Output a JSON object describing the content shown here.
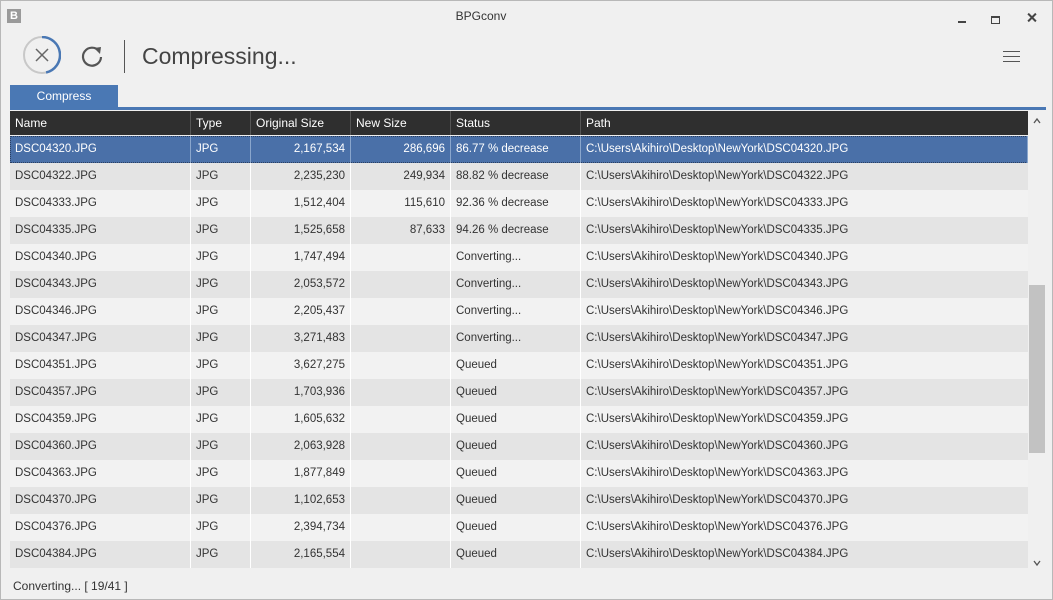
{
  "window": {
    "title": "BPGconv",
    "app_icon": "B",
    "icons": {
      "minimize": "minimize-icon",
      "maximize": "maximize-icon",
      "close": "close-icon"
    }
  },
  "toolbar": {
    "status_heading": "Compressing...",
    "icons": {
      "cancel": "cancel-x-circle-icon",
      "refresh": "refresh-icon",
      "menu": "hamburger-menu-icon"
    },
    "progress_fraction": 0.4634
  },
  "tabs": [
    {
      "label": "Compress",
      "active": true
    }
  ],
  "colors": {
    "accent": "#4a78b4",
    "selected_row": "#4a70a8",
    "header_bg": "#2f2f2f"
  },
  "table": {
    "columns": [
      "Name",
      "Type",
      "Original Size",
      "New Size",
      "Status",
      "Path"
    ],
    "rows": [
      {
        "name": "DSC04320.JPG",
        "type": "JPG",
        "original_size": "2,167,534",
        "new_size": "286,696",
        "status": "86.77 % decrease",
        "path": "C:\\Users\\Akihiro\\Desktop\\NewYork\\DSC04320.JPG",
        "selected": true
      },
      {
        "name": "DSC04322.JPG",
        "type": "JPG",
        "original_size": "2,235,230",
        "new_size": "249,934",
        "status": "88.82 % decrease",
        "path": "C:\\Users\\Akihiro\\Desktop\\NewYork\\DSC04322.JPG"
      },
      {
        "name": "DSC04333.JPG",
        "type": "JPG",
        "original_size": "1,512,404",
        "new_size": "115,610",
        "status": "92.36 % decrease",
        "path": "C:\\Users\\Akihiro\\Desktop\\NewYork\\DSC04333.JPG"
      },
      {
        "name": "DSC04335.JPG",
        "type": "JPG",
        "original_size": "1,525,658",
        "new_size": "87,633",
        "status": "94.26 % decrease",
        "path": "C:\\Users\\Akihiro\\Desktop\\NewYork\\DSC04335.JPG"
      },
      {
        "name": "DSC04340.JPG",
        "type": "JPG",
        "original_size": "1,747,494",
        "new_size": "",
        "status": "Converting...",
        "path": "C:\\Users\\Akihiro\\Desktop\\NewYork\\DSC04340.JPG"
      },
      {
        "name": "DSC04343.JPG",
        "type": "JPG",
        "original_size": "2,053,572",
        "new_size": "",
        "status": "Converting...",
        "path": "C:\\Users\\Akihiro\\Desktop\\NewYork\\DSC04343.JPG"
      },
      {
        "name": "DSC04346.JPG",
        "type": "JPG",
        "original_size": "2,205,437",
        "new_size": "",
        "status": "Converting...",
        "path": "C:\\Users\\Akihiro\\Desktop\\NewYork\\DSC04346.JPG"
      },
      {
        "name": "DSC04347.JPG",
        "type": "JPG",
        "original_size": "3,271,483",
        "new_size": "",
        "status": "Converting...",
        "path": "C:\\Users\\Akihiro\\Desktop\\NewYork\\DSC04347.JPG"
      },
      {
        "name": "DSC04351.JPG",
        "type": "JPG",
        "original_size": "3,627,275",
        "new_size": "",
        "status": "Queued",
        "path": "C:\\Users\\Akihiro\\Desktop\\NewYork\\DSC04351.JPG"
      },
      {
        "name": "DSC04357.JPG",
        "type": "JPG",
        "original_size": "1,703,936",
        "new_size": "",
        "status": "Queued",
        "path": "C:\\Users\\Akihiro\\Desktop\\NewYork\\DSC04357.JPG"
      },
      {
        "name": "DSC04359.JPG",
        "type": "JPG",
        "original_size": "1,605,632",
        "new_size": "",
        "status": "Queued",
        "path": "C:\\Users\\Akihiro\\Desktop\\NewYork\\DSC04359.JPG"
      },
      {
        "name": "DSC04360.JPG",
        "type": "JPG",
        "original_size": "2,063,928",
        "new_size": "",
        "status": "Queued",
        "path": "C:\\Users\\Akihiro\\Desktop\\NewYork\\DSC04360.JPG"
      },
      {
        "name": "DSC04363.JPG",
        "type": "JPG",
        "original_size": "1,877,849",
        "new_size": "",
        "status": "Queued",
        "path": "C:\\Users\\Akihiro\\Desktop\\NewYork\\DSC04363.JPG"
      },
      {
        "name": "DSC04370.JPG",
        "type": "JPG",
        "original_size": "1,102,653",
        "new_size": "",
        "status": "Queued",
        "path": "C:\\Users\\Akihiro\\Desktop\\NewYork\\DSC04370.JPG"
      },
      {
        "name": "DSC04376.JPG",
        "type": "JPG",
        "original_size": "2,394,734",
        "new_size": "",
        "status": "Queued",
        "path": "C:\\Users\\Akihiro\\Desktop\\NewYork\\DSC04376.JPG"
      },
      {
        "name": "DSC04384.JPG",
        "type": "JPG",
        "original_size": "2,165,554",
        "new_size": "",
        "status": "Queued",
        "path": "C:\\Users\\Akihiro\\Desktop\\NewYork\\DSC04384.JPG"
      }
    ]
  },
  "statusbar": {
    "text": "Converting... [ 19/41 ]"
  }
}
